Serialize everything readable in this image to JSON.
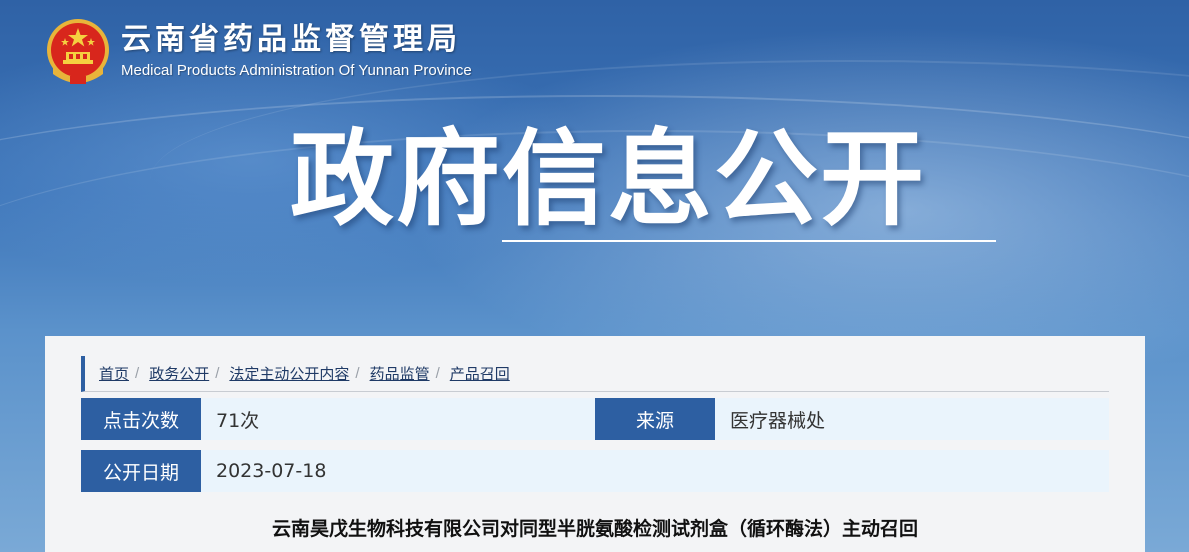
{
  "header": {
    "site_name_cn": "云南省药品监督管理局",
    "site_name_en": "Medical Products Administration Of Yunnan Province",
    "emblem_icon": "national-emblem-icon",
    "banner_title": "政府信息公开"
  },
  "breadcrumb": [
    {
      "label": "首页"
    },
    {
      "label": "政务公开"
    },
    {
      "label": "法定主动公开内容"
    },
    {
      "label": "药品监管"
    },
    {
      "label": "产品召回"
    }
  ],
  "breadcrumb_separator": "/",
  "meta": {
    "clicks_label": "点击次数",
    "clicks_value": "71次",
    "source_label": "来源",
    "source_value": "医疗器械处",
    "date_label": "公开日期",
    "date_value": "2023-07-18"
  },
  "article": {
    "title": "云南昊戊生物科技有限公司对同型半胱氨酸检测试剂盒（循环酶法）主动召回"
  },
  "colors": {
    "accent": "#2d5fa2",
    "info_bg": "#eaf4fc",
    "banner": "#3f78b8"
  }
}
